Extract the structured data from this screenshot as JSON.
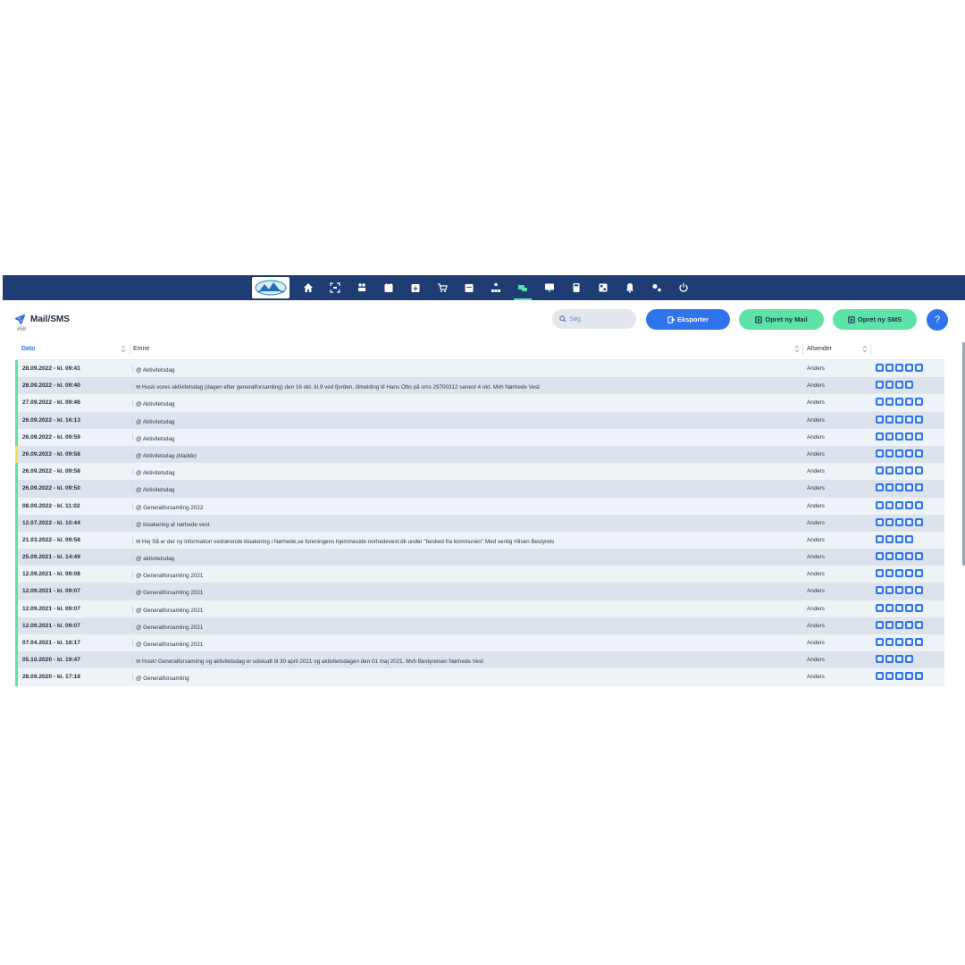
{
  "nav": {
    "icons": [
      "home-icon",
      "scan-icon",
      "users-icon",
      "calendar-check-icon",
      "calendar-plus-icon",
      "cart-icon",
      "calendar-icon",
      "sitemap-icon",
      "mail-sms-icon",
      "presentation-icon",
      "calculator-icon",
      "grid-icon",
      "bell-icon",
      "settings-icon",
      "power-icon"
    ],
    "active": "mail-sms-icon",
    "bar_color": "#1f3d73",
    "active_color": "#57e3a8"
  },
  "header": {
    "title": "Mail/SMS",
    "count": "#58",
    "search_placeholder": "Søg",
    "export_label": "Eksporter",
    "new_mail_label": "Opret ny Mail",
    "new_sms_label": "Opret ny SMS",
    "help_label": "?"
  },
  "table": {
    "columns": {
      "date": "Dato",
      "subject": "Emne",
      "sender": "Afsender"
    },
    "rows": [
      {
        "date": "28.09.2022 - kl. 09:41",
        "subject": "@ Aktivitetsdag",
        "sender": "Anders",
        "actions": 5
      },
      {
        "date": "28.09.2022 - kl. 09:40",
        "subject": "✉ Husk vores aktivitetsdag (dagen efter generalforsamling) den 16 okt. kl.9 ved fjorden, tilmelding til Hans Otto på sms 29700312 senest 4 okt. Mvh Nørhede Vest",
        "sender": "Anders",
        "actions": 4
      },
      {
        "date": "27.09.2022 - kl. 09:46",
        "subject": "@ Aktivitetsdag",
        "sender": "Anders",
        "actions": 5
      },
      {
        "date": "26.09.2022 - kl. 16:13",
        "subject": "@ Aktivitetsdag",
        "sender": "Anders",
        "actions": 5
      },
      {
        "date": "26.09.2022 - kl. 09:59",
        "subject": "@ Aktivitetsdag",
        "sender": "Anders",
        "actions": 5
      },
      {
        "date": "26.09.2022 - kl. 09:58",
        "subject": "@ Aktivitetsdag",
        "subject_note": "(kladde)",
        "sender": "Anders",
        "actions": 5,
        "draft": true
      },
      {
        "date": "26.09.2022 - kl. 09:58",
        "subject": "@ Aktivitetsdag",
        "sender": "Anders",
        "actions": 5
      },
      {
        "date": "26.09.2022 - kl. 09:50",
        "subject": "@ Aktivitetsdag",
        "sender": "Anders",
        "actions": 5
      },
      {
        "date": "08.09.2022 - kl. 11:02",
        "subject": "@ Generalforsamling 2022",
        "sender": "Anders",
        "actions": 5
      },
      {
        "date": "12.07.2022 - kl. 10:44",
        "subject": "@ kloakering af nørhede vest",
        "sender": "Anders",
        "actions": 5
      },
      {
        "date": "21.03.2022 - kl. 09:58",
        "subject": "✉ Hej Så er der ny information vedrørende kloakering i Nørhede,se foreningens hjemmeside norhedevest.dk under \"besked fra kommunen\" Med venlig Hilsen Bestyrels",
        "sender": "Anders",
        "actions": 4
      },
      {
        "date": "25.09.2021 - kl. 14:49",
        "subject": "@ aktivitetsdag",
        "sender": "Anders",
        "actions": 5
      },
      {
        "date": "12.09.2021 - kl. 09:08",
        "subject": "@ Generalforsamling 2021",
        "sender": "Anders",
        "actions": 5
      },
      {
        "date": "12.09.2021 - kl. 09:07",
        "subject": "@ Generalforsamling 2021",
        "sender": "Anders",
        "actions": 5
      },
      {
        "date": "12.09.2021 - kl. 09:07",
        "subject": "@ Generalforsamling 2021",
        "sender": "Anders",
        "actions": 5
      },
      {
        "date": "12.09.2021 - kl. 09:07",
        "subject": "@ Generalforsamling 2021",
        "sender": "Anders",
        "actions": 5
      },
      {
        "date": "07.04.2021 - kl. 18:17",
        "subject": "@ Generalforsamling 2021",
        "sender": "Anders",
        "actions": 5
      },
      {
        "date": "05.10.2020 - kl. 19:47",
        "subject": "✉ Husk! Generalforsamling og aktivitetsdag er udskudt til 30 april 2021 og aktivitetsdagen den 01 maj 2021. Mvh Bestyrelsen Nørhede Vest",
        "sender": "Anders",
        "actions": 4
      },
      {
        "date": "28.09.2020 - kl. 17:18",
        "subject": "@ Generalforsamling",
        "sender": "Anders",
        "actions": 5
      }
    ]
  },
  "colors": {
    "primary": "#2f74ec",
    "accent": "#5ee3a6",
    "draft": "#f1e15b"
  }
}
